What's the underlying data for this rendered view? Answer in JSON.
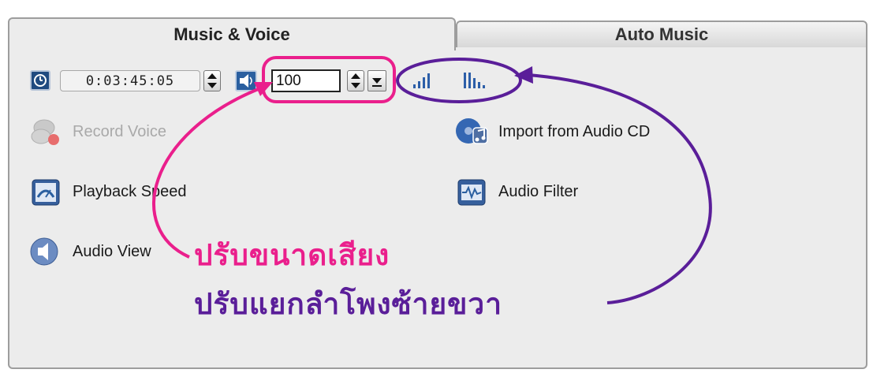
{
  "tabs": [
    {
      "label": "Music & Voice",
      "active": true
    },
    {
      "label": "Auto Music",
      "active": false
    }
  ],
  "toolbar": {
    "timecode": "0:03:45:05",
    "volume": "100"
  },
  "actions": {
    "record_voice": "Record Voice",
    "import_audio_cd": "Import from Audio CD",
    "playback_speed": "Playback Speed",
    "audio_filter": "Audio Filter",
    "audio_view": "Audio View"
  },
  "annotations": {
    "volume_note": "ปรับขนาดเสียง",
    "speaker_note": "ปรับแยกลำโพงซ้ายขวา"
  },
  "colors": {
    "annotation_pink": "#ea1f8c",
    "annotation_purple": "#5a1e99",
    "panel_bg": "#ececec",
    "icon_blue": "#2a5fa0"
  },
  "icons": [
    "clock-icon",
    "speaker-icon",
    "volume-bars-icon",
    "channel-bars-icon",
    "microphone-icon",
    "audio-cd-icon",
    "speedometer-icon",
    "waveform-icon",
    "audio-view-icon"
  ]
}
